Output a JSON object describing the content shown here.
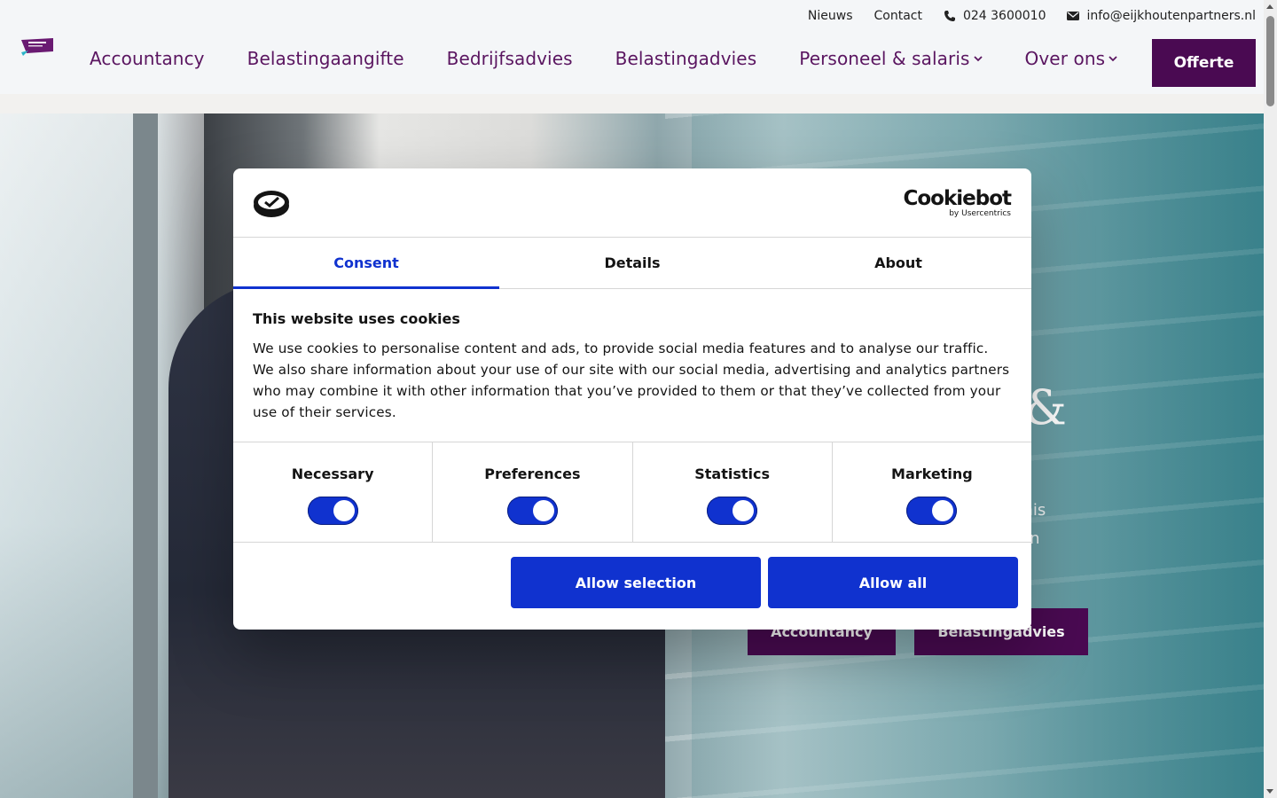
{
  "header": {
    "topbar": {
      "nieuws": "Nieuws",
      "contact": "Contact",
      "phone": "024 3600010",
      "email": "info@eijkhoutenpartners.nl"
    },
    "nav": [
      {
        "label": "Accountancy"
      },
      {
        "label": "Belastingaangifte"
      },
      {
        "label": "Bedrijfsadvies"
      },
      {
        "label": "Belastingadvies"
      },
      {
        "label": "Personeel & salaris"
      },
      {
        "label": "Over ons"
      }
    ],
    "cta": "Offerte"
  },
  "hero": {
    "heading_fragment": "s &",
    "sub_line1": "nnis",
    "sub_line2": "en",
    "buttons": [
      "Accountancy",
      "Belastingadvies"
    ]
  },
  "cookie_dialog": {
    "brand": "Cookiebot",
    "brand_sub": "by Usercentrics",
    "tabs": [
      "Consent",
      "Details",
      "About"
    ],
    "active_tab": "Consent",
    "title": "This website uses cookies",
    "text": "We use cookies to personalise content and ads, to provide social media features and to analyse our traffic. We also share information about your use of our site with our social media, advertising and analytics partners who may combine it with other information that you’ve provided to them or that they’ve collected from your use of their services.",
    "toggles": [
      {
        "label": "Necessary",
        "on": true
      },
      {
        "label": "Preferences",
        "on": true
      },
      {
        "label": "Statistics",
        "on": true
      },
      {
        "label": "Marketing",
        "on": true
      }
    ],
    "allow_selection": "Allow selection",
    "allow_all": "Allow all",
    "accent_color": "#1032cf"
  },
  "colors": {
    "brand_purple": "#4a0a52",
    "nav_text": "#5a1560"
  }
}
